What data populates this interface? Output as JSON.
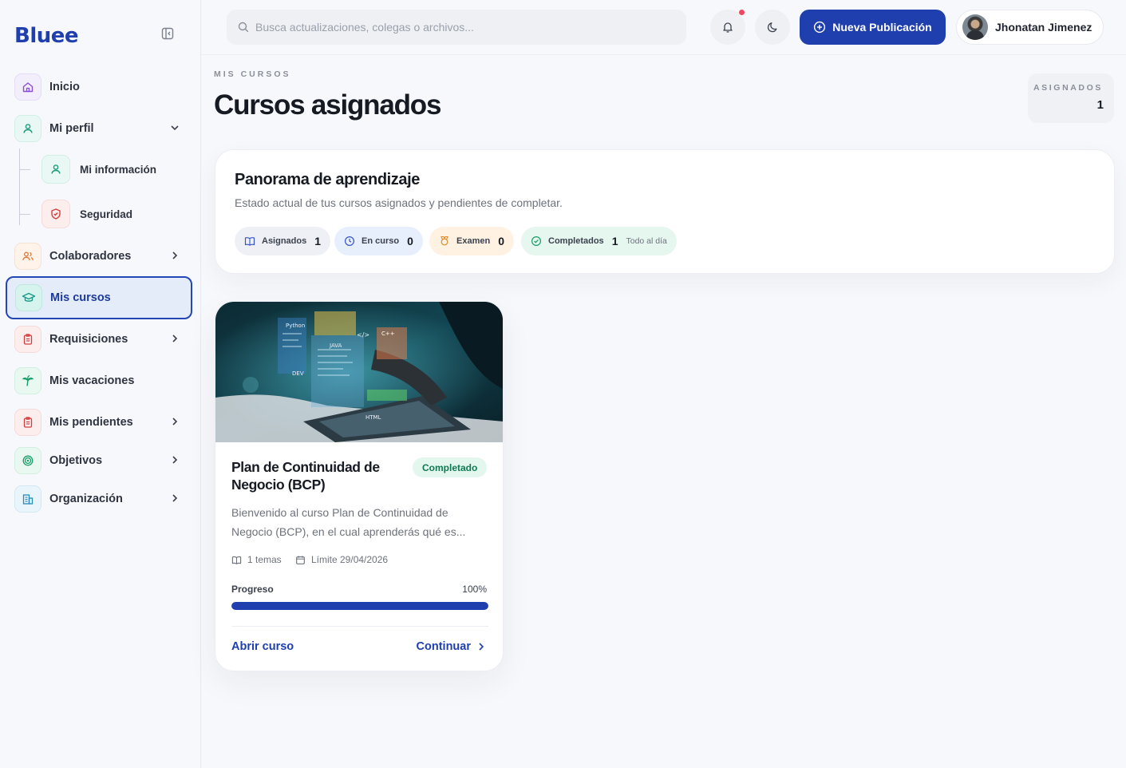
{
  "brand": "Bluee",
  "sidebar": {
    "items": [
      {
        "label": "Inicio",
        "icon": "home-icon"
      },
      {
        "label": "Mi perfil",
        "icon": "user-icon"
      },
      {
        "label": "Colaboradores",
        "icon": "users-icon"
      },
      {
        "label": "Mis cursos",
        "icon": "graduation-cap-icon"
      },
      {
        "label": "Requisiciones",
        "icon": "clipboard-icon"
      },
      {
        "label": "Mis vacaciones",
        "icon": "palm-tree-icon"
      },
      {
        "label": "Mis pendientes",
        "icon": "clipboard-list-icon"
      },
      {
        "label": "Objetivos",
        "icon": "target-icon"
      },
      {
        "label": "Organización",
        "icon": "building-icon"
      }
    ],
    "profile_sub": [
      {
        "label": "Mi información",
        "icon": "user-icon"
      },
      {
        "label": "Seguridad",
        "icon": "shield-icon"
      }
    ]
  },
  "topbar": {
    "search_placeholder": "Busca actualizaciones, colegas o archivos...",
    "new_post_label": "Nueva Publicación",
    "user_name": "Jhonatan Jimenez"
  },
  "page": {
    "eyebrow": "MIS CURSOS",
    "title": "Cursos asignados",
    "assigned_label": "ASIGNADOS",
    "assigned_value": "1"
  },
  "overview": {
    "title": "Panorama de aprendizaje",
    "subtitle": "Estado actual de tus cursos asignados y pendientes de completar.",
    "pills": [
      {
        "label": "Asignados",
        "value": "1",
        "note": "",
        "color": "#eef0f6"
      },
      {
        "label": "En curso",
        "value": "0",
        "note": "",
        "color": "#e8effc"
      },
      {
        "label": "Examen",
        "value": "0",
        "note": "",
        "color": "#fff2e3"
      },
      {
        "label": "Completados",
        "value": "1",
        "note": "Todo al día",
        "color": "#e6f7ef"
      }
    ]
  },
  "course": {
    "title": "Plan de Continuidad de Negocio (BCP)",
    "status": "Completado",
    "description": "Bienvenido al curso Plan de Continuidad de Negocio (BCP), en el cual aprenderás qué es...",
    "topics": "1 temas",
    "deadline": "Límite 29/04/2026",
    "progress_label": "Progreso",
    "progress_text": "100%",
    "progress": 1.0,
    "open_label": "Abrir curso",
    "continue_label": "Continuar",
    "image_labels": [
      "Python",
      "</>",
      "C++",
      "JAVA",
      "DEV",
      "HTML"
    ]
  },
  "colors": {
    "accent": "#1f3fae",
    "notification": "#ef4a61",
    "success": "#0f7a52"
  }
}
